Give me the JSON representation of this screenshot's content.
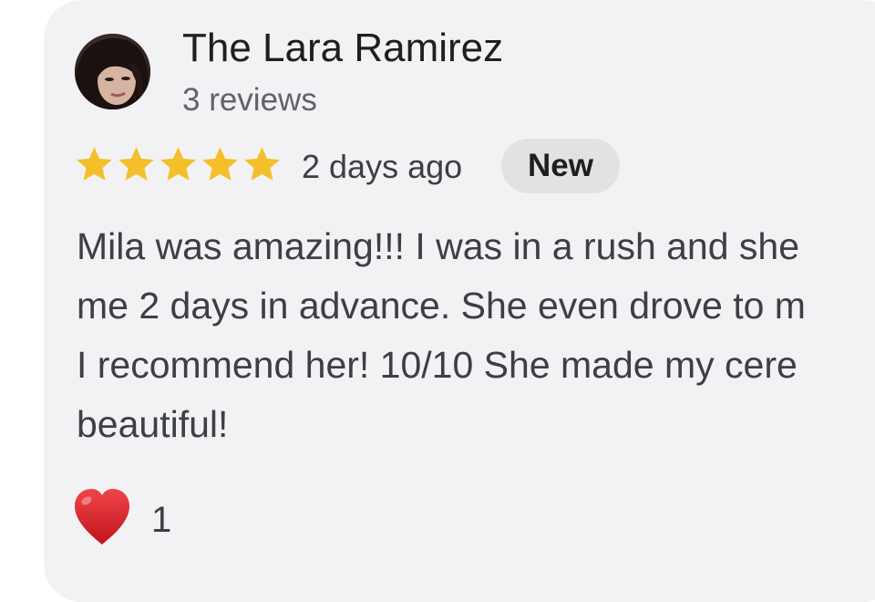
{
  "review": {
    "author_name": "The Lara Ramirez",
    "author_reviews": "3 reviews",
    "rating": 5,
    "rating_max": 5,
    "date": "2 days ago",
    "badge": "New",
    "text_lines": [
      "Mila was amazing!!! I was in a rush and she",
      "me 2 days in advance. She even drove to m",
      "I recommend her! 10/10 She made my cere",
      "beautiful!"
    ],
    "reaction_icon": "heart-icon",
    "reaction_count": "1"
  },
  "colors": {
    "card_bg": "#f2f2f4",
    "star": "#f4bf2a",
    "badge_bg": "#e2e2e5",
    "heart": "#d3202a"
  }
}
